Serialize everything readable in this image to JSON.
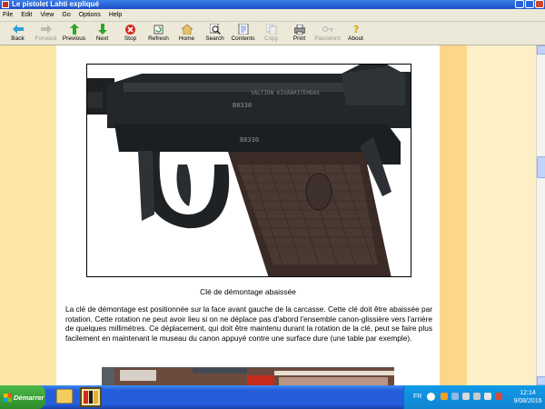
{
  "window": {
    "title": "Le pistolet Lahti expliqué"
  },
  "menu": [
    "File",
    "Edit",
    "View",
    "Go",
    "Options",
    "Help"
  ],
  "toolbar": [
    {
      "label": "Back",
      "icon": "back-arrow-icon",
      "enabled": true
    },
    {
      "label": "Forward",
      "icon": "forward-arrow-icon",
      "enabled": false
    },
    {
      "label": "Previous",
      "icon": "up-arrow-icon",
      "enabled": true
    },
    {
      "label": "Next",
      "icon": "down-arrow-icon",
      "enabled": true
    },
    {
      "label": "Stop",
      "icon": "stop-icon",
      "enabled": true
    },
    {
      "label": "Refresh",
      "icon": "refresh-icon",
      "enabled": true
    },
    {
      "label": "Home",
      "icon": "home-icon",
      "enabled": true
    },
    {
      "label": "Search",
      "icon": "search-icon",
      "enabled": true
    },
    {
      "label": "Contents",
      "icon": "contents-icon",
      "enabled": true
    },
    {
      "label": "Copy",
      "icon": "copy-icon",
      "enabled": false
    },
    {
      "label": "Print",
      "icon": "print-icon",
      "enabled": true
    },
    {
      "label": "Password",
      "icon": "password-icon",
      "enabled": false
    },
    {
      "label": "About",
      "icon": "about-icon",
      "enabled": true
    }
  ],
  "article": {
    "caption": "Clé de démontage abaissée",
    "paragraph": "La clé de démontage est positionnée sur la face avant gauche de la carcasse. Cette clé doit être abaissée par rotation. Cette rotation ne peut avoir lieu si on ne déplace pas d'abord l'ensemble canon-glissière vers l'arrière de quelques millimètres. Ce déplacement, qui doit être maintenu durant la rotation de la clé, peut se faire plus facilement en maintenant le museau du canon appuyé contre une surface dure (une table par exemple).",
    "photo_engraving": "VALTION KIVÄÄRITEHDAS",
    "photo_serial": "B8330"
  },
  "taskbar": {
    "start_label": "Démarrer",
    "language": "FR",
    "time": "12:14",
    "date": "9/08/2016"
  },
  "colors": {
    "title_bar": "#1b50c8",
    "left_band": "#fde7a5",
    "right_band": "#fcd68b",
    "page_background": "#ffffff",
    "taskbar": "#245edb",
    "start_button": "#2e8b2a"
  }
}
